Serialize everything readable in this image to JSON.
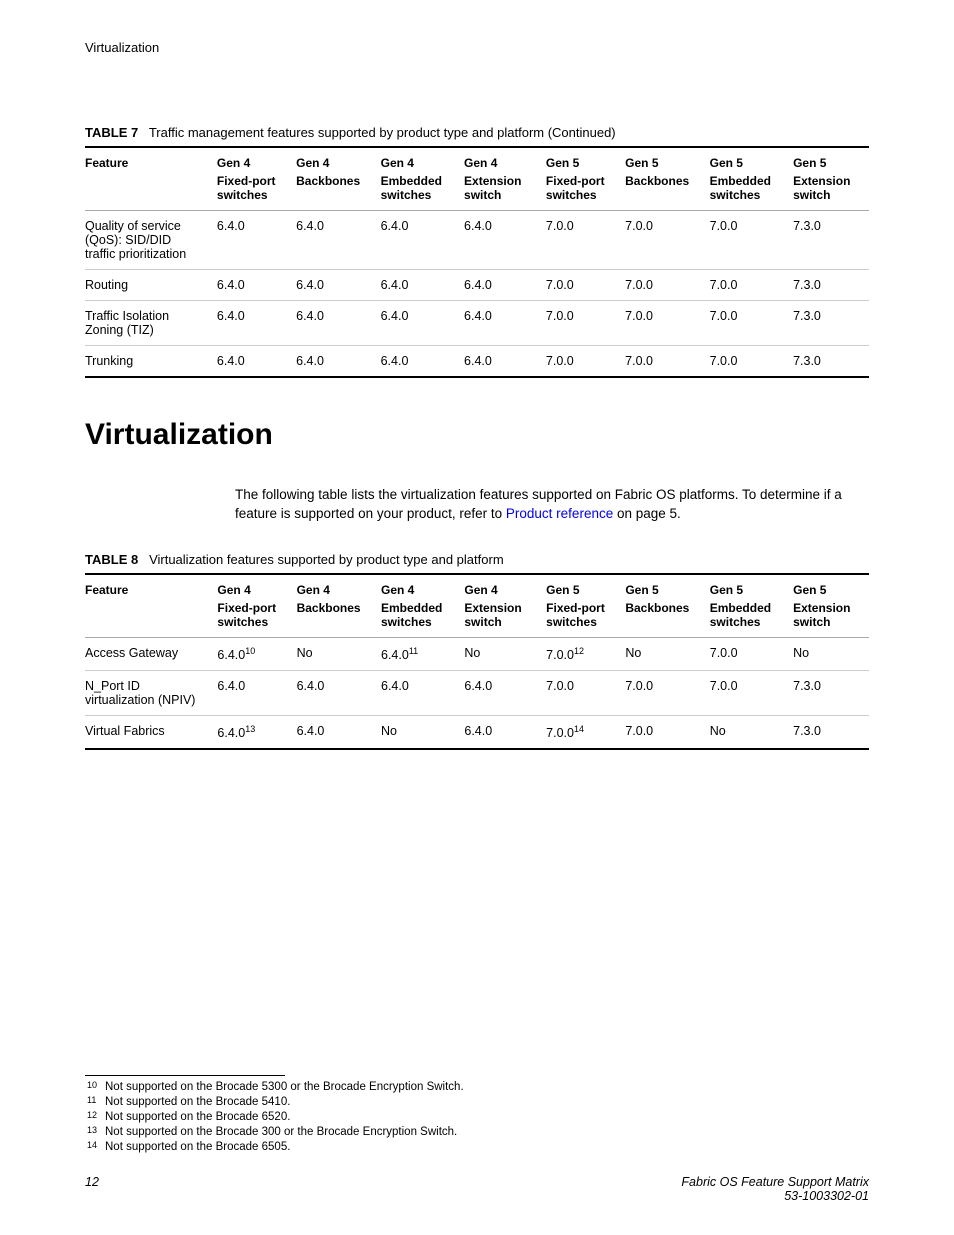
{
  "header": {
    "section": "Virtualization"
  },
  "table7": {
    "caption_label": "TABLE 7",
    "caption_text": "Traffic management features supported by product type and platform (Continued)",
    "head1": [
      "Feature",
      "Gen 4",
      "Gen 4",
      "Gen 4",
      "Gen 4",
      "Gen 5",
      "Gen 5",
      "Gen 5",
      "Gen 5"
    ],
    "head2": [
      "",
      "Fixed-port switches",
      "Backbones",
      "Embedded switches",
      "Extension switch",
      "Fixed-port switches",
      "Backbones",
      "Embedded switches",
      "Extension switch"
    ],
    "rows": [
      [
        "Quality of service (QoS): SID/DID traffic prioritization",
        "6.4.0",
        "6.4.0",
        "6.4.0",
        "6.4.0",
        "7.0.0",
        "7.0.0",
        "7.0.0",
        "7.3.0"
      ],
      [
        "Routing",
        "6.4.0",
        "6.4.0",
        "6.4.0",
        "6.4.0",
        "7.0.0",
        "7.0.0",
        "7.0.0",
        "7.3.0"
      ],
      [
        "Traffic Isolation Zoning (TIZ)",
        "6.4.0",
        "6.4.0",
        "6.4.0",
        "6.4.0",
        "7.0.0",
        "7.0.0",
        "7.0.0",
        "7.3.0"
      ],
      [
        "Trunking",
        "6.4.0",
        "6.4.0",
        "6.4.0",
        "6.4.0",
        "7.0.0",
        "7.0.0",
        "7.0.0",
        "7.3.0"
      ]
    ]
  },
  "section_heading": "Virtualization",
  "intro": {
    "text_before": "The following table lists the virtualization features supported on Fabric OS platforms. To determine if a feature is supported on your product, refer to ",
    "link_text": "Product reference",
    "text_after": " on page 5."
  },
  "table8": {
    "caption_label": "TABLE 8",
    "caption_text": "Virtualization features supported by product type and platform",
    "head1": [
      "Feature",
      "Gen 4",
      "Gen 4",
      "Gen 4",
      "Gen 4",
      "Gen 5",
      "Gen 5",
      "Gen 5",
      "Gen 5"
    ],
    "head2": [
      "",
      "Fixed-port switches",
      "Backbones",
      "Embedded switches",
      "Extension switch",
      "Fixed-port switches",
      "Backbones",
      "Embedded switches",
      "Extension switch"
    ],
    "rows": [
      {
        "feature": "Access Gateway",
        "c1": "6.4.0",
        "s1": "10",
        "c2": "No",
        "c3": "6.4.0",
        "s3": "11",
        "c4": "No",
        "c5": "7.0.0",
        "s5": "12",
        "c6": "No",
        "c7": "7.0.0",
        "c8": "No"
      },
      {
        "feature": "N_Port ID virtualization (NPIV)",
        "c1": "6.4.0",
        "c2": "6.4.0",
        "c3": "6.4.0",
        "c4": "6.4.0",
        "c5": "7.0.0",
        "c6": "7.0.0",
        "c7": "7.0.0",
        "c8": "7.3.0"
      },
      {
        "feature": "Virtual Fabrics",
        "c1": "6.4.0",
        "s1": "13",
        "c2": "6.4.0",
        "c3": "No",
        "c4": "6.4.0",
        "c5": "7.0.0",
        "s5": "14",
        "c6": "7.0.0",
        "c7": "No",
        "c8": "7.3.0"
      }
    ]
  },
  "footnotes": [
    {
      "num": "10",
      "text": "Not supported on the Brocade 5300 or the Brocade Encryption Switch."
    },
    {
      "num": "11",
      "text": "Not supported on the Brocade 5410."
    },
    {
      "num": "12",
      "text": "Not supported on the Brocade 6520."
    },
    {
      "num": "13",
      "text": "Not supported on the Brocade 300 or the Brocade Encryption Switch."
    },
    {
      "num": "14",
      "text": "Not supported on the Brocade 6505."
    }
  ],
  "footer": {
    "pagenum": "12",
    "title": "Fabric OS Feature Support Matrix",
    "docnum": "53-1003302-01"
  }
}
